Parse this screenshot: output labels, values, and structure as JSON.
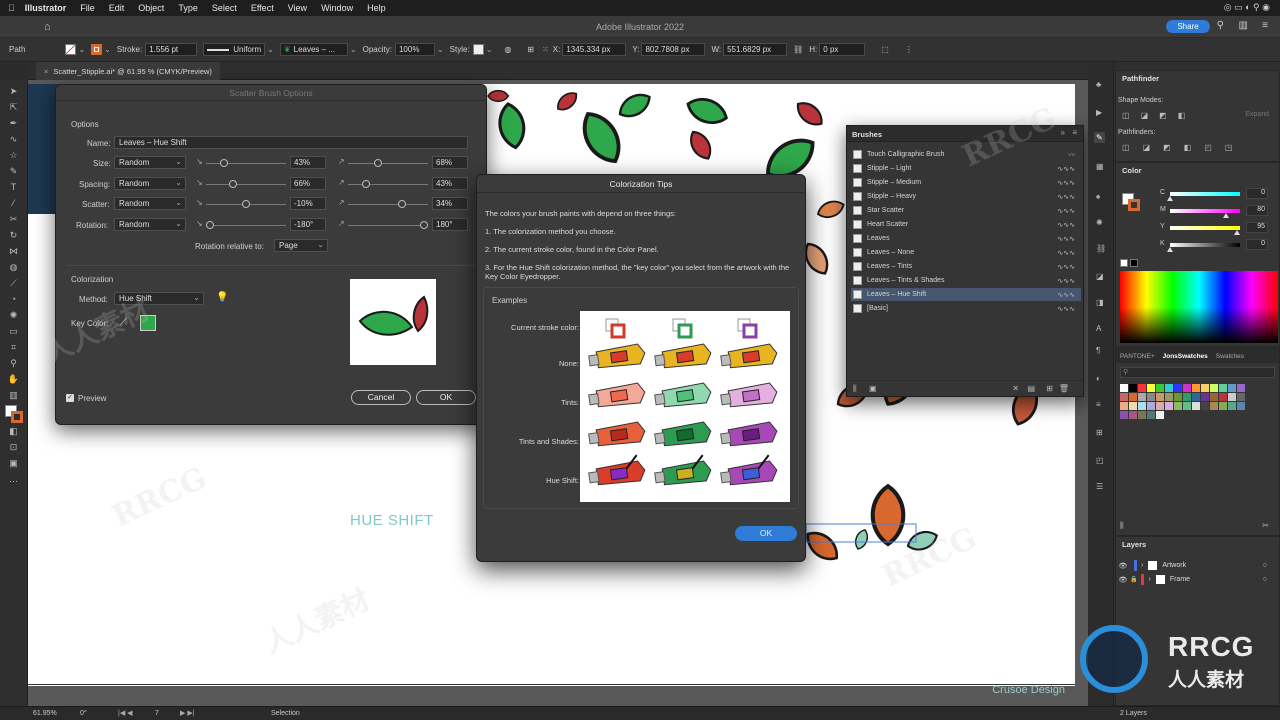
{
  "menubar": {
    "app": "Illustrator",
    "items": [
      "File",
      "Edit",
      "Object",
      "Type",
      "Select",
      "Effect",
      "View",
      "Window",
      "Help"
    ],
    "clock": "Share"
  },
  "appbar": {
    "title": "Adobe Illustrator 2022",
    "share": "Share"
  },
  "control": {
    "selection": "Path",
    "stroke_label": "Stroke:",
    "stroke_value": "1.556 pt",
    "profile": "Uniform",
    "brush": "Leaves – ...",
    "opacity_label": "Opacity:",
    "opacity_value": "100%",
    "style_label": "Style:",
    "x_label": "X:",
    "x_value": "1345.334 px",
    "y_label": "Y:",
    "y_value": "802.7808 px",
    "w_label": "W:",
    "w_value": "551.6829 px",
    "h_label": "H:",
    "h_value": "0 px"
  },
  "doc_tab": "Scatter_Stipple.ai* @ 61.95 % (CMYK/Preview)",
  "canvas": {
    "hue_shift_text": "HUE SHIFT",
    "credit": "Crusoe Design"
  },
  "scatter_dialog": {
    "title": "Scatter Brush Options",
    "options_heading": "Options",
    "name_label": "Name:",
    "name_value": "Leaves – Hue Shift",
    "rows": [
      {
        "label": "Size:",
        "mode": "Random",
        "v1": "43%",
        "v2": "68%"
      },
      {
        "label": "Spacing:",
        "mode": "Random",
        "v1": "66%",
        "v2": "43%"
      },
      {
        "label": "Scatter:",
        "mode": "Random",
        "v1": "-10%",
        "v2": "34%"
      },
      {
        "label": "Rotation:",
        "mode": "Random",
        "v1": "-180°",
        "v2": "180°"
      }
    ],
    "rotation_relative_label": "Rotation relative to:",
    "rotation_relative_value": "Page",
    "colorization_heading": "Colorization",
    "method_label": "Method:",
    "method_value": "Hue Shift",
    "key_color_label": "Key Color:",
    "preview_label": "Preview",
    "cancel": "Cancel",
    "ok": "OK"
  },
  "tips_dialog": {
    "title": "Colorization Tips",
    "intro": "The colors your brush paints with depend on three things:",
    "p1": "1. The colorization method you choose.",
    "p2": "2. The current stroke color, found in the Color Panel.",
    "p3": "3. For the Hue Shift colorization method, the \"key color\" you select from the artwork with the Key Color Eyedropper.",
    "examples_heading": "Examples",
    "row_labels": [
      "Current stroke color:",
      "None:",
      "Tints:",
      "Tints and Shades:",
      "Hue Shift:"
    ],
    "ok": "OK"
  },
  "brushes_panel": {
    "title": "Brushes",
    "items": [
      "Touch Calligraphic Brush",
      "Stipple – Light",
      "Stipple – Medium",
      "Stipple – Heavy",
      "Star Scatter",
      "Heart Scatter",
      "Leaves",
      "Leaves – None",
      "Leaves – Tints",
      "Leaves – Tints & Shades",
      "Leaves – Hue Shift",
      "[Basic]"
    ],
    "selected_index": 10
  },
  "pathfinder": {
    "title": "Pathfinder",
    "shape_modes": "Shape Modes:",
    "pathfinders": "Pathfinders:",
    "expand": "Expand"
  },
  "color_panel": {
    "title": "Color",
    "channels": [
      {
        "name": "C",
        "value": "0"
      },
      {
        "name": "M",
        "value": "80"
      },
      {
        "name": "Y",
        "value": "95"
      },
      {
        "name": "K",
        "value": "0"
      }
    ]
  },
  "swatches_tabs": [
    "PANTONE+",
    "JonsSwatches",
    "Swatches"
  ],
  "layers": {
    "title": "Layers",
    "items": [
      "Artwork",
      "Frame"
    ],
    "count": "2 Layers"
  },
  "status": {
    "zoom": "61.95%",
    "rotate": "0°",
    "artboard": "7",
    "tool": "Selection"
  },
  "colors": {
    "accent_blue": "#2f7bd8",
    "leaf_green": "#2ea84a",
    "leaf_red": "#b8343a",
    "leaf_orange": "#d9682e",
    "leaf_teal": "#8fcfb8"
  }
}
